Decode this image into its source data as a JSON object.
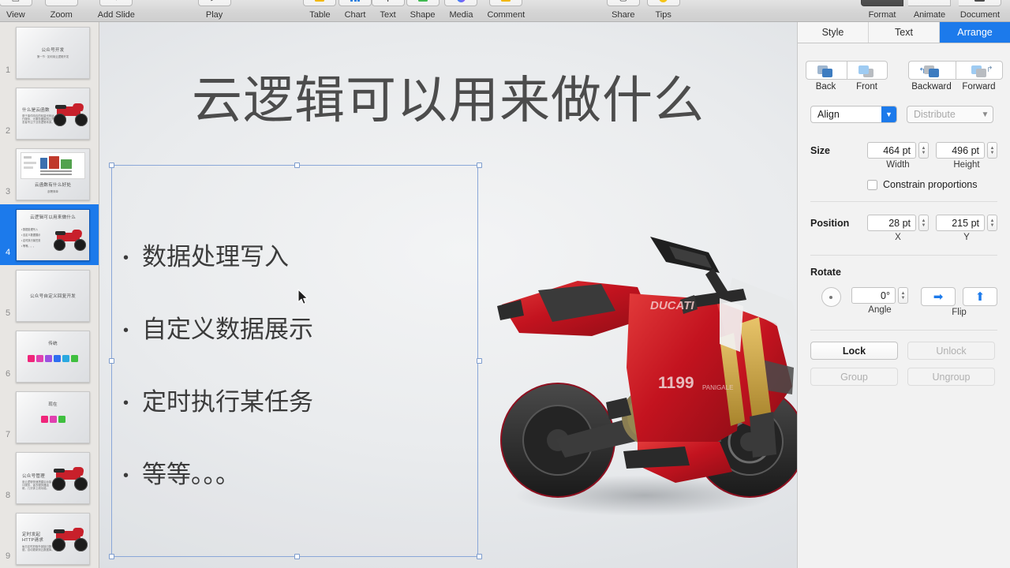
{
  "toolbar": {
    "groups": [
      {
        "items": [
          {
            "label": "View",
            "icon": "view-icon",
            "glyph": "▤",
            "color": "#7d7d7d",
            "dark": false
          },
          {
            "label": "Zoom",
            "icon": "zoom-icon",
            "glyph": "⌗",
            "color": "#9a9a9a",
            "dark": false
          },
          {
            "label": "Add Slide",
            "icon": "add-slide-icon",
            "glyph": "＋",
            "color": "#9a9a9a",
            "dark": false
          }
        ]
      },
      {
        "items": [
          {
            "label": "Play",
            "icon": "play-icon",
            "glyph": "▶",
            "color": "#7d7d7d",
            "dark": false
          }
        ]
      },
      {
        "items": [
          {
            "label": "Table",
            "icon": "table-icon",
            "glyph": "",
            "color": "#f2b705",
            "dark": false
          },
          {
            "label": "Chart",
            "icon": "chart-icon",
            "glyph": "",
            "color": "#2a7fe0",
            "dark": false
          },
          {
            "label": "Text",
            "icon": "text-icon",
            "glyph": "T",
            "color": "#6d6d6d",
            "dark": false
          },
          {
            "label": "Shape",
            "icon": "shape-icon",
            "glyph": "",
            "color": "#3fb950",
            "dark": false
          },
          {
            "label": "Media",
            "icon": "media-icon",
            "glyph": "",
            "color": "#9b59d0",
            "dark": false
          },
          {
            "label": "Comment",
            "icon": "comment-icon",
            "glyph": "",
            "color": "#f2b705",
            "dark": false
          }
        ]
      },
      {
        "items": [
          {
            "label": "Share",
            "icon": "share-icon",
            "glyph": "▢",
            "color": "#8a8a8a",
            "dark": false
          },
          {
            "label": "Tips",
            "icon": "tips-icon",
            "glyph": "",
            "color": "#f5c518",
            "dark": false
          }
        ]
      },
      {
        "items": [
          {
            "label": "Format",
            "icon": "format-brush-icon",
            "glyph": "🖌",
            "color": "#e6e6e6",
            "dark": true
          },
          {
            "label": "Animate",
            "icon": "animate-icon",
            "glyph": "✧",
            "color": "#7d7d7d",
            "dark": false
          },
          {
            "label": "Document",
            "icon": "document-icon",
            "glyph": "▬",
            "color": "#4a4a4a",
            "dark": false
          }
        ]
      }
    ]
  },
  "navigator": {
    "slides": [
      {
        "number": "1",
        "title": "公众号开发",
        "subtitle": "第一节 · 如何用云逻辑开发",
        "kind": "title"
      },
      {
        "number": "2",
        "title": "什么是云函数",
        "subtitle": "基于事件响应的轻量代码运行服务，无服务器架构让开发者专注于业务逻辑本身。",
        "kind": "title-moto"
      },
      {
        "number": "3",
        "title": "云函数有什么好处",
        "subtitle": "部署简单",
        "kind": "diagram"
      },
      {
        "number": "4",
        "title": "云逻辑可以用来做什么",
        "bullets": [
          "数据处理写入",
          "自定义数据展示",
          "定时执行某任务",
          "等等。。。"
        ],
        "kind": "bullets-moto",
        "selected": true
      },
      {
        "number": "5",
        "title": "公众号自定义回复开发",
        "subtitle": "",
        "kind": "center-title"
      },
      {
        "number": "6",
        "title": "传统",
        "kind": "chips",
        "chips": [
          "#f0257a",
          "#e040b0",
          "#9b51e0",
          "#2d6ef0",
          "#2aa9e0",
          "#3fbf3f"
        ]
      },
      {
        "number": "7",
        "title": "现在",
        "kind": "chips",
        "chips": [
          "#f0257a",
          "#e040b0",
          "#3fbf3f"
        ]
      },
      {
        "number": "8",
        "title": "公众号管理",
        "subtitle": "用云逻辑快速搭建后台接口服务，省去服务器运维，几分钟上线功能。",
        "kind": "title-moto-left"
      },
      {
        "number": "9",
        "title": "定时发起\nHTTP请求",
        "subtitle": "每日定时抓取外部接口数据，自动更新到云数据库。",
        "kind": "title-moto-left"
      }
    ]
  },
  "slide": {
    "title": "云逻辑可以用来做什么",
    "bullet_char": "•",
    "bullets": [
      "数据处理写入",
      "自定义数据展示",
      "定时执行某任务",
      "等等。。。"
    ]
  },
  "inspector": {
    "tabs": [
      {
        "label": "Style",
        "active": false
      },
      {
        "label": "Text",
        "active": false
      },
      {
        "label": "Arrange",
        "active": true
      }
    ],
    "arrange": {
      "order_buttons": [
        {
          "label": "Back",
          "icon": "send-to-back-icon"
        },
        {
          "label": "Front",
          "icon": "bring-to-front-icon"
        },
        {
          "label": "Backward",
          "icon": "send-backward-icon"
        },
        {
          "label": "Forward",
          "icon": "bring-forward-icon"
        }
      ],
      "align_label": "Align",
      "distribute_label": "Distribute",
      "distribute_disabled": true
    },
    "size": {
      "label": "Size",
      "width_value": "464 pt",
      "width_caption": "Width",
      "height_value": "496 pt",
      "height_caption": "Height",
      "constrain_label": "Constrain proportions",
      "constrain_checked": false
    },
    "position": {
      "label": "Position",
      "x_value": "28 pt",
      "x_caption": "X",
      "y_value": "215 pt",
      "y_caption": "Y"
    },
    "rotate": {
      "label": "Rotate",
      "angle_value": "0°",
      "angle_caption": "Angle",
      "flip_caption": "Flip",
      "flip_horizontal_icon": "arrow-right-icon",
      "flip_vertical_icon": "arrow-up-icon"
    },
    "actions": [
      {
        "label": "Lock",
        "disabled": false
      },
      {
        "label": "Unlock",
        "disabled": true
      },
      {
        "label": "Group",
        "disabled": true
      },
      {
        "label": "Ungroup",
        "disabled": true
      }
    ]
  },
  "colors": {
    "accent": "#1c7aeb",
    "toolbar_bg": "#d8d8d8",
    "inspector_bg": "#f2f2f2",
    "navigator_bg": "#e8e6e3",
    "motorcycle_red": "#c8202b"
  }
}
